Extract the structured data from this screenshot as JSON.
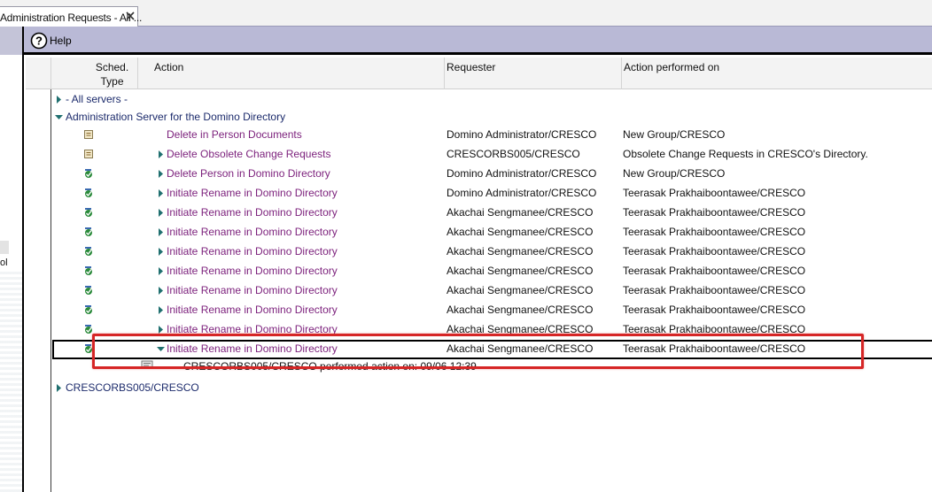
{
  "tab": {
    "title": "Administration Requests - All ..."
  },
  "action_bar": {
    "help_label": "Help"
  },
  "navigator": {
    "partial_text": "ol"
  },
  "columns": [
    {
      "id": "sched",
      "label": "Sched. Type"
    },
    {
      "id": "action",
      "label": "Action"
    },
    {
      "id": "requester",
      "label": "Requester"
    },
    {
      "id": "performed",
      "label": "Action performed on"
    }
  ],
  "rows": [
    {
      "kind": "category",
      "twisty": "collapsed",
      "text": "- All servers -"
    },
    {
      "kind": "category",
      "twisty": "expanded",
      "text": "Administration Server for the Domino Directory"
    },
    {
      "kind": "doc",
      "icon": "immediate-request-icon",
      "twisty": "none",
      "action": "Delete in Person Documents",
      "requester": "Domino Administrator/CRESCO",
      "performed_on": "New Group/CRESCO"
    },
    {
      "kind": "doc",
      "icon": "immediate-request-icon",
      "twisty": "collapsed",
      "action": "Delete Obsolete Change Requests",
      "requester": "CRESCORBS005/CRESCO",
      "performed_on": "Obsolete Change Requests in CRESCO's Directory."
    },
    {
      "kind": "doc",
      "icon": "scheduled-request-icon",
      "twisty": "collapsed",
      "action": "Delete Person in Domino Directory",
      "requester": "Domino Administrator/CRESCO",
      "performed_on": "New Group/CRESCO"
    },
    {
      "kind": "doc",
      "icon": "scheduled-request-icon",
      "twisty": "collapsed",
      "action": "Initiate Rename in Domino Directory",
      "requester": "Domino Administrator/CRESCO",
      "performed_on": "Teerasak Prakhaiboontawee/CRESCO"
    },
    {
      "kind": "doc",
      "icon": "scheduled-request-icon",
      "twisty": "collapsed",
      "action": "Initiate Rename in Domino Directory",
      "requester": "Akachai Sengmanee/CRESCO",
      "performed_on": "Teerasak Prakhaiboontawee/CRESCO"
    },
    {
      "kind": "doc",
      "icon": "scheduled-request-icon",
      "twisty": "collapsed",
      "action": "Initiate Rename in Domino Directory",
      "requester": "Akachai Sengmanee/CRESCO",
      "performed_on": "Teerasak Prakhaiboontawee/CRESCO"
    },
    {
      "kind": "doc",
      "icon": "scheduled-request-icon",
      "twisty": "collapsed",
      "action": "Initiate Rename in Domino Directory",
      "requester": "Akachai Sengmanee/CRESCO",
      "performed_on": "Teerasak Prakhaiboontawee/CRESCO"
    },
    {
      "kind": "doc",
      "icon": "scheduled-request-icon",
      "twisty": "collapsed",
      "action": "Initiate Rename in Domino Directory",
      "requester": "Akachai Sengmanee/CRESCO",
      "performed_on": "Teerasak Prakhaiboontawee/CRESCO"
    },
    {
      "kind": "doc",
      "icon": "scheduled-request-icon",
      "twisty": "collapsed",
      "action": "Initiate Rename in Domino Directory",
      "requester": "Akachai Sengmanee/CRESCO",
      "performed_on": "Teerasak Prakhaiboontawee/CRESCO"
    },
    {
      "kind": "doc",
      "icon": "scheduled-request-icon",
      "twisty": "collapsed",
      "action": "Initiate Rename in Domino Directory",
      "requester": "Akachai Sengmanee/CRESCO",
      "performed_on": "Teerasak Prakhaiboontawee/CRESCO"
    },
    {
      "kind": "doc",
      "icon": "scheduled-request-icon",
      "twisty": "collapsed",
      "action": "Initiate Rename in Domino Directory",
      "requester": "Akachai Sengmanee/CRESCO",
      "performed_on": "Teerasak Prakhaiboontawee/CRESCO"
    },
    {
      "kind": "doc",
      "icon": "scheduled-request-icon",
      "twisty": "expanded",
      "selected": true,
      "action": "Initiate Rename in Domino Directory",
      "requester": "Akachai Sengmanee/CRESCO",
      "performed_on": "Teerasak Prakhaiboontawee/CRESCO"
    },
    {
      "kind": "response",
      "icon": "response-doc-icon",
      "text": "CRESCORBS005/CRESCO performed action on: 09/06 12:39"
    },
    {
      "kind": "category",
      "twisty": "collapsed",
      "text": "CRESCORBS005/CRESCO"
    }
  ],
  "colors": {
    "action_bar": "#b9b9d6",
    "action_text": "#7b1f7b",
    "category_text": "#1b2a6b",
    "highlight": "#d62626",
    "twisty": "#1f6f6f"
  }
}
